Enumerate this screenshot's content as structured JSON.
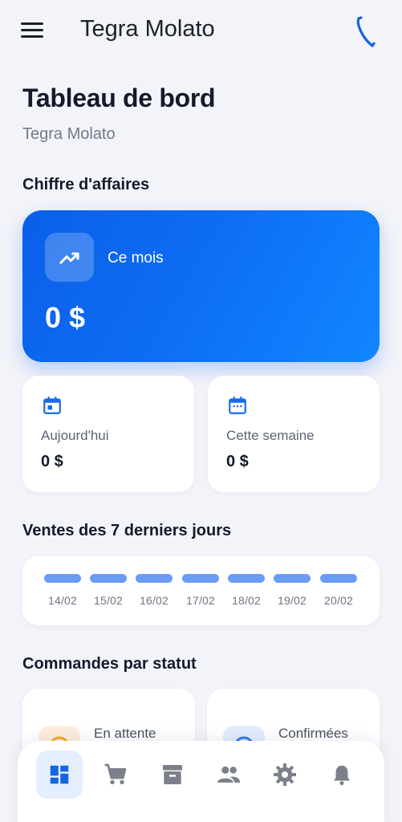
{
  "appbar": {
    "title": "Tegra Molato",
    "menu_icon": "menu-icon",
    "phone_icon": "phone-icon"
  },
  "page": {
    "title": "Tableau de bord",
    "subtitle": "Tegra Molato"
  },
  "revenue": {
    "section_title": "Chiffre d'affaires",
    "month": {
      "label": "Ce mois",
      "value": "0 $",
      "icon": "trending-up-icon"
    },
    "today": {
      "label": "Aujourd'hui",
      "value": "0 $",
      "icon": "calendar-today-icon"
    },
    "week": {
      "label": "Cette semaine",
      "value": "0 $",
      "icon": "calendar-week-icon"
    }
  },
  "sales": {
    "section_title": "Ventes des 7 derniers jours",
    "days": [
      "14/02",
      "15/02",
      "16/02",
      "17/02",
      "18/02",
      "19/02",
      "20/02"
    ]
  },
  "orders": {
    "section_title": "Commandes par statut",
    "pending": {
      "label": "En attente"
    },
    "confirmed": {
      "label": "Confirmées"
    }
  },
  "nav": {
    "items": [
      {
        "name": "dashboard",
        "icon": "dashboard-icon",
        "active": true
      },
      {
        "name": "orders",
        "icon": "cart-icon",
        "active": false
      },
      {
        "name": "products",
        "icon": "archive-icon",
        "active": false
      },
      {
        "name": "customers",
        "icon": "people-icon",
        "active": false
      },
      {
        "name": "settings",
        "icon": "gear-icon",
        "active": false
      },
      {
        "name": "notifications",
        "icon": "bell-icon",
        "active": false
      }
    ]
  },
  "colors": {
    "accent": "#0d6cf4",
    "background": "#f3f4f9",
    "pending": "#f7a81b",
    "confirmed": "#2f78e8"
  }
}
